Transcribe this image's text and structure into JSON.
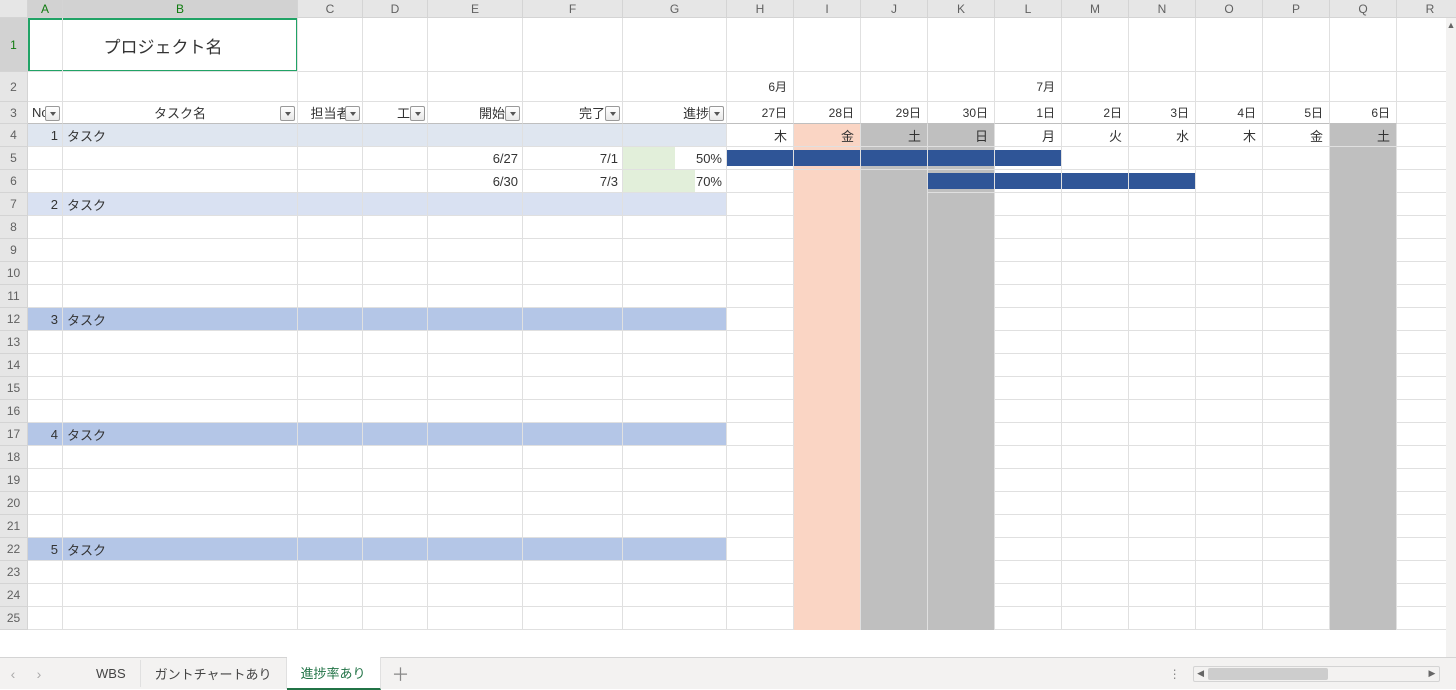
{
  "title": "プロジェクト名",
  "columns": [
    "A",
    "B",
    "C",
    "D",
    "E",
    "F",
    "G",
    "H",
    "I",
    "J",
    "K",
    "L",
    "M",
    "N",
    "O",
    "P",
    "Q",
    "R"
  ],
  "selected_cols": [
    "A",
    "B"
  ],
  "row_count": 25,
  "selected_rows": [
    1
  ],
  "headers": {
    "no": "No.",
    "task": "タスク名",
    "assignee": "担当者",
    "effort": "工数",
    "start": "開始日",
    "end": "完了日",
    "progress": "進捗率"
  },
  "months": {
    "m1": "6月",
    "m2": "7月"
  },
  "dates": [
    "27日",
    "28日",
    "29日",
    "30日",
    "1日",
    "2日",
    "3日",
    "4日",
    "5日",
    "6日"
  ],
  "dows": [
    "木",
    "金",
    "土",
    "日",
    "月",
    "火",
    "水",
    "木",
    "金",
    "土"
  ],
  "today_index": 1,
  "weekend_indices": [
    2,
    3,
    9
  ],
  "tasks": [
    {
      "no": "1",
      "label": "タスク",
      "style": "task-group-1",
      "row": 4
    },
    {
      "no": "2",
      "label": "タスク",
      "style": "task-group-2",
      "row": 7
    },
    {
      "no": "3",
      "label": "タスク",
      "style": "task-group-n",
      "row": 12
    },
    {
      "no": "4",
      "label": "タスク",
      "style": "task-group-n",
      "row": 17
    },
    {
      "no": "5",
      "label": "タスク",
      "style": "task-group-n",
      "row": 22
    }
  ],
  "entries": [
    {
      "row": 5,
      "start": "6/27",
      "end": "7/1",
      "progress": "50%",
      "bar_from": 0,
      "bar_to": 4
    },
    {
      "row": 6,
      "start": "6/30",
      "end": "7/3",
      "progress": "70%",
      "bar_from": 3,
      "bar_to": 6
    }
  ],
  "tabs": {
    "items": [
      "WBS",
      "ガントチャートあり",
      "進捗率あり"
    ],
    "active_index": 2,
    "add": "＋"
  }
}
